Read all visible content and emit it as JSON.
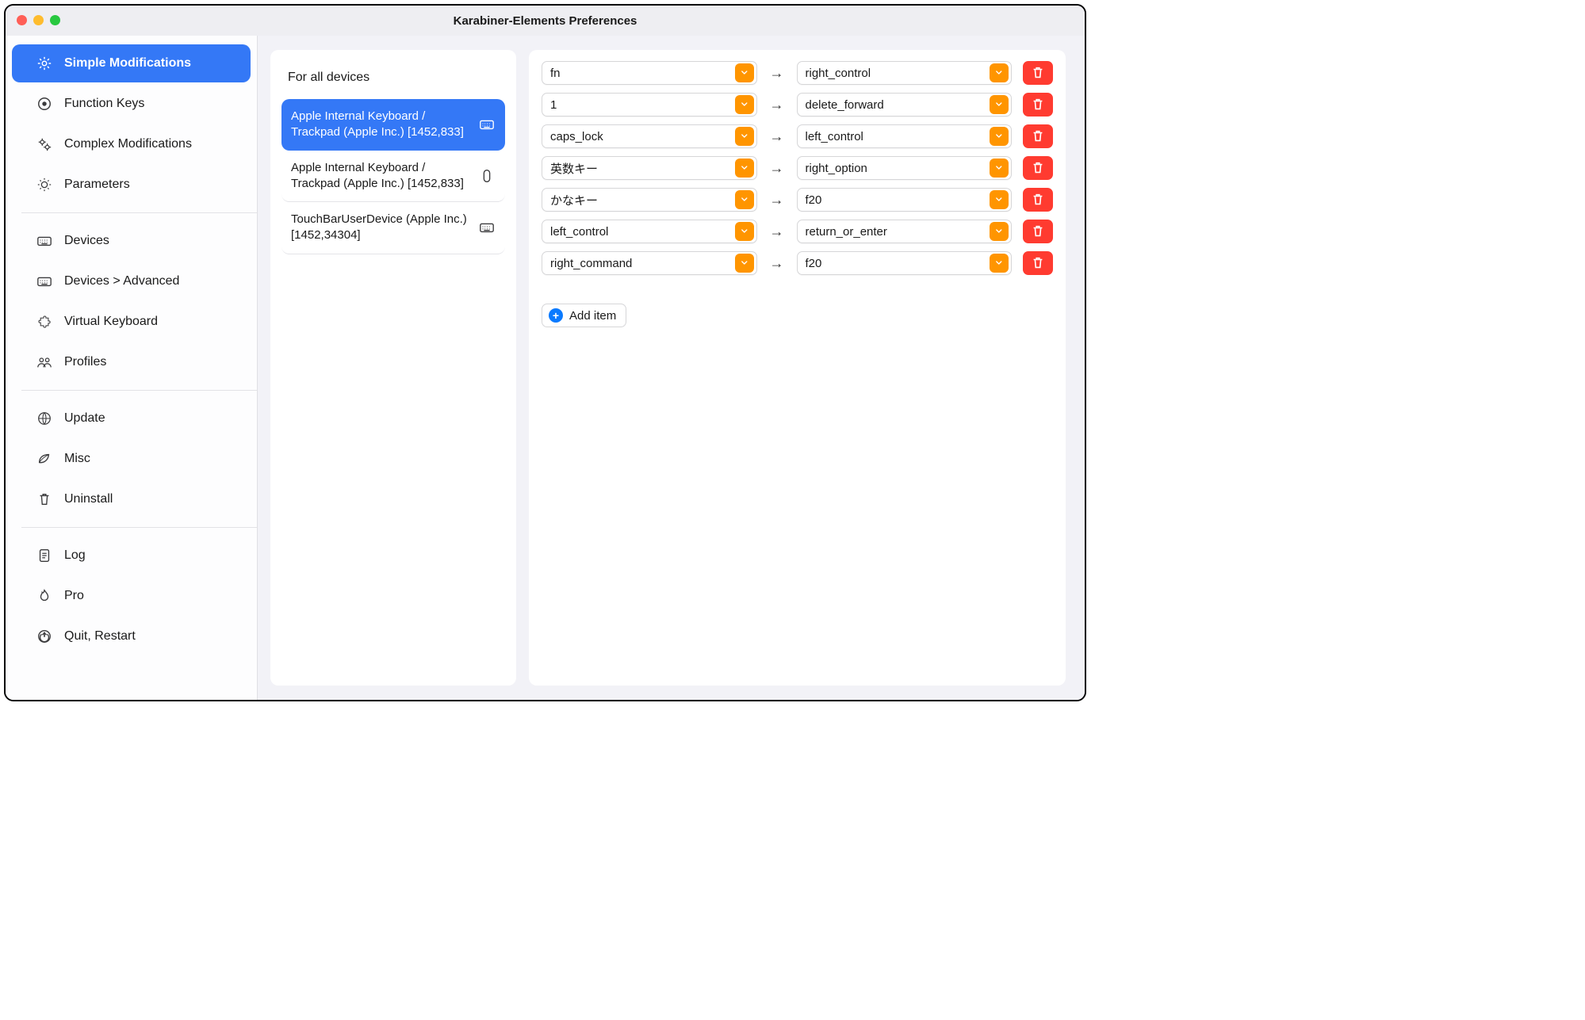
{
  "window": {
    "title": "Karabiner-Elements Preferences"
  },
  "sidebar": {
    "groups": [
      {
        "items": [
          {
            "label": "Simple Modifications",
            "icon": "gear-icon",
            "active": true
          },
          {
            "label": "Function Keys",
            "icon": "target-icon",
            "active": false
          },
          {
            "label": "Complex Modifications",
            "icon": "gears-icon",
            "active": false
          },
          {
            "label": "Parameters",
            "icon": "sun-icon",
            "active": false
          }
        ]
      },
      {
        "items": [
          {
            "label": "Devices",
            "icon": "keyboard-icon",
            "active": false
          },
          {
            "label": "Devices > Advanced",
            "icon": "keyboard-icon",
            "active": false
          },
          {
            "label": "Virtual Keyboard",
            "icon": "puzzle-icon",
            "active": false
          },
          {
            "label": "Profiles",
            "icon": "people-icon",
            "active": false
          }
        ]
      },
      {
        "items": [
          {
            "label": "Update",
            "icon": "globe-icon",
            "active": false
          },
          {
            "label": "Misc",
            "icon": "leaf-icon",
            "active": false
          },
          {
            "label": "Uninstall",
            "icon": "trash-icon",
            "active": false
          }
        ]
      },
      {
        "items": [
          {
            "label": "Log",
            "icon": "doc-icon",
            "active": false
          },
          {
            "label": "Pro",
            "icon": "flame-icon",
            "active": false
          },
          {
            "label": "Quit, Restart",
            "icon": "power-icon",
            "active": false
          }
        ]
      }
    ]
  },
  "devices": {
    "header": "For all devices",
    "items": [
      {
        "label": "Apple Internal Keyboard / Trackpad (Apple Inc.) [1452,833]",
        "icon": "keyboard-icon",
        "active": true
      },
      {
        "label": "Apple Internal Keyboard / Trackpad (Apple Inc.) [1452,833]",
        "icon": "mouse-icon",
        "active": false
      },
      {
        "label": "TouchBarUserDevice (Apple Inc.) [1452,34304]",
        "icon": "keyboard-icon",
        "active": false
      }
    ]
  },
  "mappings": [
    {
      "from": "fn",
      "to": "right_control"
    },
    {
      "from": "1",
      "to": "delete_forward"
    },
    {
      "from": "caps_lock",
      "to": "left_control"
    },
    {
      "from": "英数キー",
      "to": "right_option"
    },
    {
      "from": "かなキー",
      "to": "f20"
    },
    {
      "from": "left_control",
      "to": "return_or_enter"
    },
    {
      "from": "right_command",
      "to": "f20"
    }
  ],
  "add_item_label": "Add item",
  "colors": {
    "accent": "#3478f6",
    "orange": "#ff9500",
    "red": "#ff3b30"
  }
}
